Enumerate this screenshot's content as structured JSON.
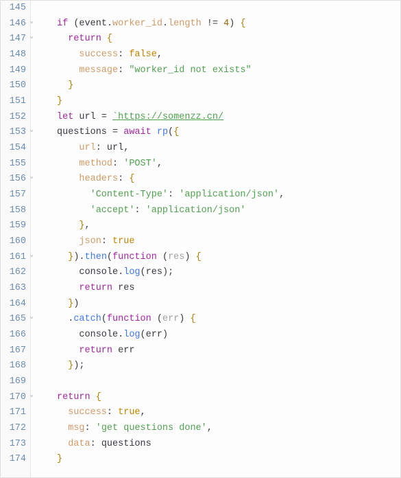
{
  "editor": {
    "first_line": 145,
    "fold_glyph": "⌄",
    "lines": [
      {
        "num": 145,
        "fold": false,
        "tokens": []
      },
      {
        "num": 146,
        "fold": true,
        "tokens": [
          {
            "t": "if ",
            "c": "tok-kw"
          },
          {
            "t": "(",
            "c": "tok-punc"
          },
          {
            "t": "event",
            "c": "tok-id"
          },
          {
            "t": ".",
            "c": "tok-punc"
          },
          {
            "t": "worker_id",
            "c": "tok-prop"
          },
          {
            "t": ".",
            "c": "tok-punc"
          },
          {
            "t": "length",
            "c": "tok-prop"
          },
          {
            "t": " != ",
            "c": "tok-punc"
          },
          {
            "t": "4",
            "c": "tok-num"
          },
          {
            "t": ")",
            "c": "tok-punc"
          },
          {
            "t": " {",
            "c": "tok-brace"
          }
        ]
      },
      {
        "num": 147,
        "fold": true,
        "tokens": [
          {
            "t": "  ",
            "c": ""
          },
          {
            "t": "return ",
            "c": "tok-kw"
          },
          {
            "t": "{",
            "c": "tok-brace"
          }
        ]
      },
      {
        "num": 148,
        "fold": false,
        "tokens": [
          {
            "t": "    ",
            "c": ""
          },
          {
            "t": "success",
            "c": "tok-prop"
          },
          {
            "t": ": ",
            "c": "tok-punc"
          },
          {
            "t": "false",
            "c": "tok-bool"
          },
          {
            "t": ",",
            "c": "tok-punc"
          }
        ]
      },
      {
        "num": 149,
        "fold": false,
        "tokens": [
          {
            "t": "    ",
            "c": ""
          },
          {
            "t": "message",
            "c": "tok-prop"
          },
          {
            "t": ": ",
            "c": "tok-punc"
          },
          {
            "t": "\"worker_id not exists\"",
            "c": "tok-str"
          }
        ]
      },
      {
        "num": 150,
        "fold": false,
        "tokens": [
          {
            "t": "  ",
            "c": ""
          },
          {
            "t": "}",
            "c": "tok-brace"
          }
        ]
      },
      {
        "num": 151,
        "fold": false,
        "tokens": [
          {
            "t": "}",
            "c": "tok-brace"
          }
        ]
      },
      {
        "num": 152,
        "fold": false,
        "tokens": [
          {
            "t": "let ",
            "c": "tok-kw"
          },
          {
            "t": "url",
            "c": "tok-id"
          },
          {
            "t": " = ",
            "c": "tok-punc"
          },
          {
            "t": "`https://somenzz.cn/",
            "c": "tok-str2"
          }
        ]
      },
      {
        "num": 153,
        "fold": true,
        "tokens": [
          {
            "t": "questions",
            "c": "tok-id"
          },
          {
            "t": " = ",
            "c": "tok-punc"
          },
          {
            "t": "await ",
            "c": "tok-kw"
          },
          {
            "t": "rp",
            "c": "tok-fn"
          },
          {
            "t": "(",
            "c": "tok-punc"
          },
          {
            "t": "{",
            "c": "tok-brace"
          }
        ]
      },
      {
        "num": 154,
        "fold": false,
        "tokens": [
          {
            "t": "    ",
            "c": ""
          },
          {
            "t": "url",
            "c": "tok-prop"
          },
          {
            "t": ": ",
            "c": "tok-punc"
          },
          {
            "t": "url",
            "c": "tok-id"
          },
          {
            "t": ",",
            "c": "tok-punc"
          }
        ]
      },
      {
        "num": 155,
        "fold": false,
        "tokens": [
          {
            "t": "    ",
            "c": ""
          },
          {
            "t": "method",
            "c": "tok-prop"
          },
          {
            "t": ": ",
            "c": "tok-punc"
          },
          {
            "t": "'POST'",
            "c": "tok-str"
          },
          {
            "t": ",",
            "c": "tok-punc"
          }
        ]
      },
      {
        "num": 156,
        "fold": true,
        "tokens": [
          {
            "t": "    ",
            "c": ""
          },
          {
            "t": "headers",
            "c": "tok-prop"
          },
          {
            "t": ": ",
            "c": "tok-punc"
          },
          {
            "t": "{",
            "c": "tok-brace"
          }
        ]
      },
      {
        "num": 157,
        "fold": false,
        "tokens": [
          {
            "t": "      ",
            "c": ""
          },
          {
            "t": "'Content-Type'",
            "c": "tok-str"
          },
          {
            "t": ": ",
            "c": "tok-punc"
          },
          {
            "t": "'application/json'",
            "c": "tok-str"
          },
          {
            "t": ",",
            "c": "tok-punc"
          }
        ]
      },
      {
        "num": 158,
        "fold": false,
        "tokens": [
          {
            "t": "      ",
            "c": ""
          },
          {
            "t": "'accept'",
            "c": "tok-str"
          },
          {
            "t": ": ",
            "c": "tok-punc"
          },
          {
            "t": "'application/json'",
            "c": "tok-str"
          }
        ]
      },
      {
        "num": 159,
        "fold": false,
        "tokens": [
          {
            "t": "    ",
            "c": ""
          },
          {
            "t": "}",
            "c": "tok-brace"
          },
          {
            "t": ",",
            "c": "tok-punc"
          }
        ]
      },
      {
        "num": 160,
        "fold": false,
        "tokens": [
          {
            "t": "    ",
            "c": ""
          },
          {
            "t": "json",
            "c": "tok-prop"
          },
          {
            "t": ": ",
            "c": "tok-punc"
          },
          {
            "t": "true",
            "c": "tok-bool"
          }
        ]
      },
      {
        "num": 161,
        "fold": true,
        "tokens": [
          {
            "t": "  ",
            "c": ""
          },
          {
            "t": "}",
            "c": "tok-brace"
          },
          {
            "t": ").",
            "c": "tok-punc"
          },
          {
            "t": "then",
            "c": "tok-fn"
          },
          {
            "t": "(",
            "c": "tok-punc"
          },
          {
            "t": "function ",
            "c": "tok-kw"
          },
          {
            "t": "(",
            "c": "tok-punc"
          },
          {
            "t": "res",
            "c": "tok-param"
          },
          {
            "t": ")",
            "c": "tok-punc"
          },
          {
            "t": " {",
            "c": "tok-brace"
          }
        ]
      },
      {
        "num": 162,
        "fold": false,
        "tokens": [
          {
            "t": "    ",
            "c": ""
          },
          {
            "t": "console",
            "c": "tok-id"
          },
          {
            "t": ".",
            "c": "tok-punc"
          },
          {
            "t": "log",
            "c": "tok-fn"
          },
          {
            "t": "(",
            "c": "tok-punc"
          },
          {
            "t": "res",
            "c": "tok-id"
          },
          {
            "t": ");",
            "c": "tok-punc"
          }
        ]
      },
      {
        "num": 163,
        "fold": false,
        "tokens": [
          {
            "t": "    ",
            "c": ""
          },
          {
            "t": "return ",
            "c": "tok-kw"
          },
          {
            "t": "res",
            "c": "tok-id"
          }
        ]
      },
      {
        "num": 164,
        "fold": false,
        "tokens": [
          {
            "t": "  ",
            "c": ""
          },
          {
            "t": "}",
            "c": "tok-brace"
          },
          {
            "t": ")",
            "c": "tok-punc"
          }
        ]
      },
      {
        "num": 165,
        "fold": true,
        "tokens": [
          {
            "t": "  .",
            "c": "tok-punc"
          },
          {
            "t": "catch",
            "c": "tok-fn"
          },
          {
            "t": "(",
            "c": "tok-punc"
          },
          {
            "t": "function ",
            "c": "tok-kw"
          },
          {
            "t": "(",
            "c": "tok-punc"
          },
          {
            "t": "err",
            "c": "tok-param"
          },
          {
            "t": ")",
            "c": "tok-punc"
          },
          {
            "t": " {",
            "c": "tok-brace"
          }
        ]
      },
      {
        "num": 166,
        "fold": false,
        "tokens": [
          {
            "t": "    ",
            "c": ""
          },
          {
            "t": "console",
            "c": "tok-id"
          },
          {
            "t": ".",
            "c": "tok-punc"
          },
          {
            "t": "log",
            "c": "tok-fn"
          },
          {
            "t": "(",
            "c": "tok-punc"
          },
          {
            "t": "err",
            "c": "tok-id"
          },
          {
            "t": ")",
            "c": "tok-punc"
          }
        ]
      },
      {
        "num": 167,
        "fold": false,
        "tokens": [
          {
            "t": "    ",
            "c": ""
          },
          {
            "t": "return ",
            "c": "tok-kw"
          },
          {
            "t": "err",
            "c": "tok-id"
          }
        ]
      },
      {
        "num": 168,
        "fold": false,
        "tokens": [
          {
            "t": "  ",
            "c": ""
          },
          {
            "t": "}",
            "c": "tok-brace"
          },
          {
            "t": ");",
            "c": "tok-punc"
          }
        ]
      },
      {
        "num": 169,
        "fold": false,
        "tokens": []
      },
      {
        "num": 170,
        "fold": true,
        "tokens": [
          {
            "t": "return ",
            "c": "tok-kw"
          },
          {
            "t": "{",
            "c": "tok-brace"
          }
        ]
      },
      {
        "num": 171,
        "fold": false,
        "tokens": [
          {
            "t": "  ",
            "c": ""
          },
          {
            "t": "success",
            "c": "tok-prop"
          },
          {
            "t": ": ",
            "c": "tok-punc"
          },
          {
            "t": "true",
            "c": "tok-bool"
          },
          {
            "t": ",",
            "c": "tok-punc"
          }
        ]
      },
      {
        "num": 172,
        "fold": false,
        "tokens": [
          {
            "t": "  ",
            "c": ""
          },
          {
            "t": "msg",
            "c": "tok-prop"
          },
          {
            "t": ": ",
            "c": "tok-punc"
          },
          {
            "t": "'get questions done'",
            "c": "tok-str"
          },
          {
            "t": ",",
            "c": "tok-punc"
          }
        ]
      },
      {
        "num": 173,
        "fold": false,
        "tokens": [
          {
            "t": "  ",
            "c": ""
          },
          {
            "t": "data",
            "c": "tok-prop"
          },
          {
            "t": ": ",
            "c": "tok-punc"
          },
          {
            "t": "questions",
            "c": "tok-id"
          }
        ]
      },
      {
        "num": 174,
        "fold": false,
        "tokens": [
          {
            "t": "}",
            "c": "tok-brace"
          }
        ]
      }
    ]
  }
}
